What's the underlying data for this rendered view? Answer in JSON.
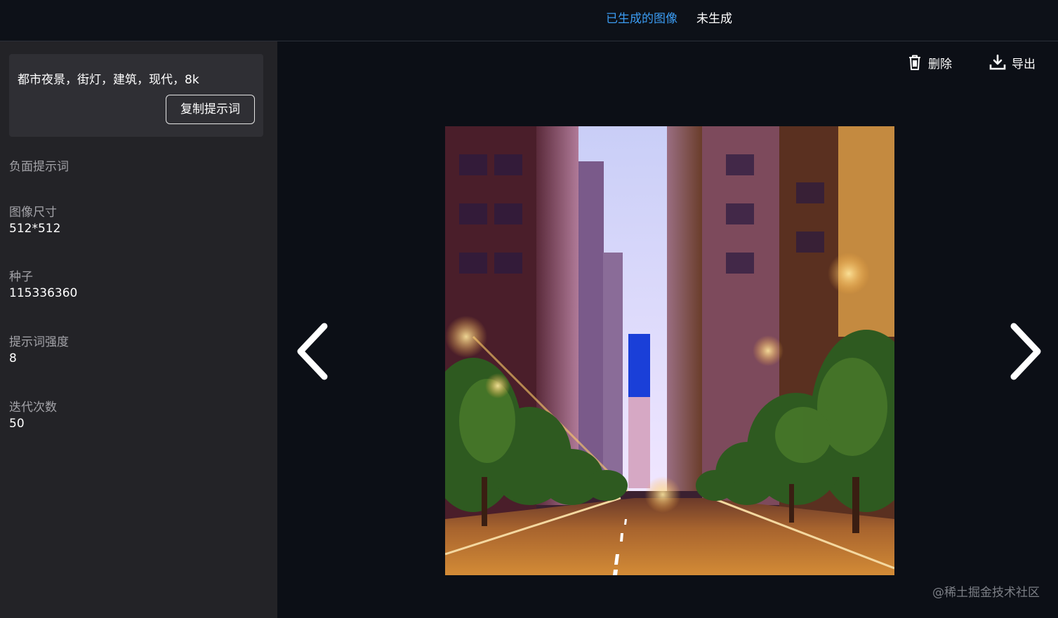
{
  "tabs": [
    {
      "label": "已生成的图像",
      "active": true
    },
    {
      "label": "未生成",
      "active": false
    }
  ],
  "sidebar": {
    "prompt": "都市夜景，街灯，建筑，现代，8k",
    "copy_button": "复制提示词",
    "fields": [
      {
        "label": "负面提示词",
        "value": ""
      },
      {
        "label": "图像尺寸",
        "value": "512*512"
      },
      {
        "label": "种子",
        "value": "115336360"
      },
      {
        "label": "提示词强度",
        "value": "8"
      },
      {
        "label": "迭代次数",
        "value": "50"
      }
    ]
  },
  "toolbar": {
    "delete_label": "删除",
    "export_label": "导出",
    "delete_icon": "trash-icon",
    "export_icon": "download-icon"
  },
  "viewer": {
    "prev_icon": "chevron-left-icon",
    "next_icon": "chevron-right-icon"
  },
  "watermark": "@稀土掘金技术社区",
  "colors": {
    "accent": "#3b9cf2",
    "sidebar_bg": "#232327",
    "main_bg": "#0c0f16"
  }
}
